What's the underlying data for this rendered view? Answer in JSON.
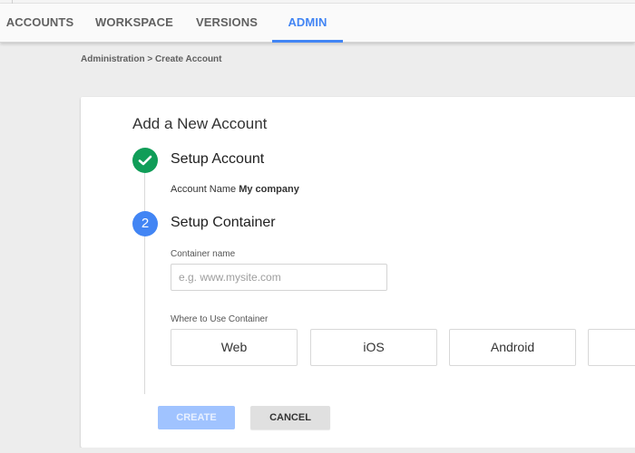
{
  "nav": {
    "tabs": [
      {
        "label": "ACCOUNTS",
        "active": false
      },
      {
        "label": "WORKSPACE",
        "active": false
      },
      {
        "label": "VERSIONS",
        "active": false
      },
      {
        "label": "ADMIN",
        "active": true
      }
    ]
  },
  "breadcrumb": "Administration > Create Account",
  "card": {
    "title": "Add a New Account",
    "step1": {
      "number": "1",
      "status": "complete",
      "icon": "check-icon",
      "title": "Setup Account",
      "account_label": "Account Name",
      "account_value": "My company"
    },
    "step2": {
      "number": "2",
      "status": "active",
      "title": "Setup Container",
      "container_label": "Container name",
      "container_value": "",
      "container_placeholder": "e.g. www.mysite.com",
      "where_label": "Where to Use Container",
      "platforms": [
        "Web",
        "iOS",
        "Android",
        ""
      ]
    },
    "buttons": {
      "create": "CREATE",
      "cancel": "CANCEL"
    }
  },
  "colors": {
    "accent": "#4285f4",
    "success": "#109d58",
    "create_disabled": "#a0c3ff",
    "cancel_bg": "#e0e0e0",
    "page_bg": "#ededed"
  }
}
